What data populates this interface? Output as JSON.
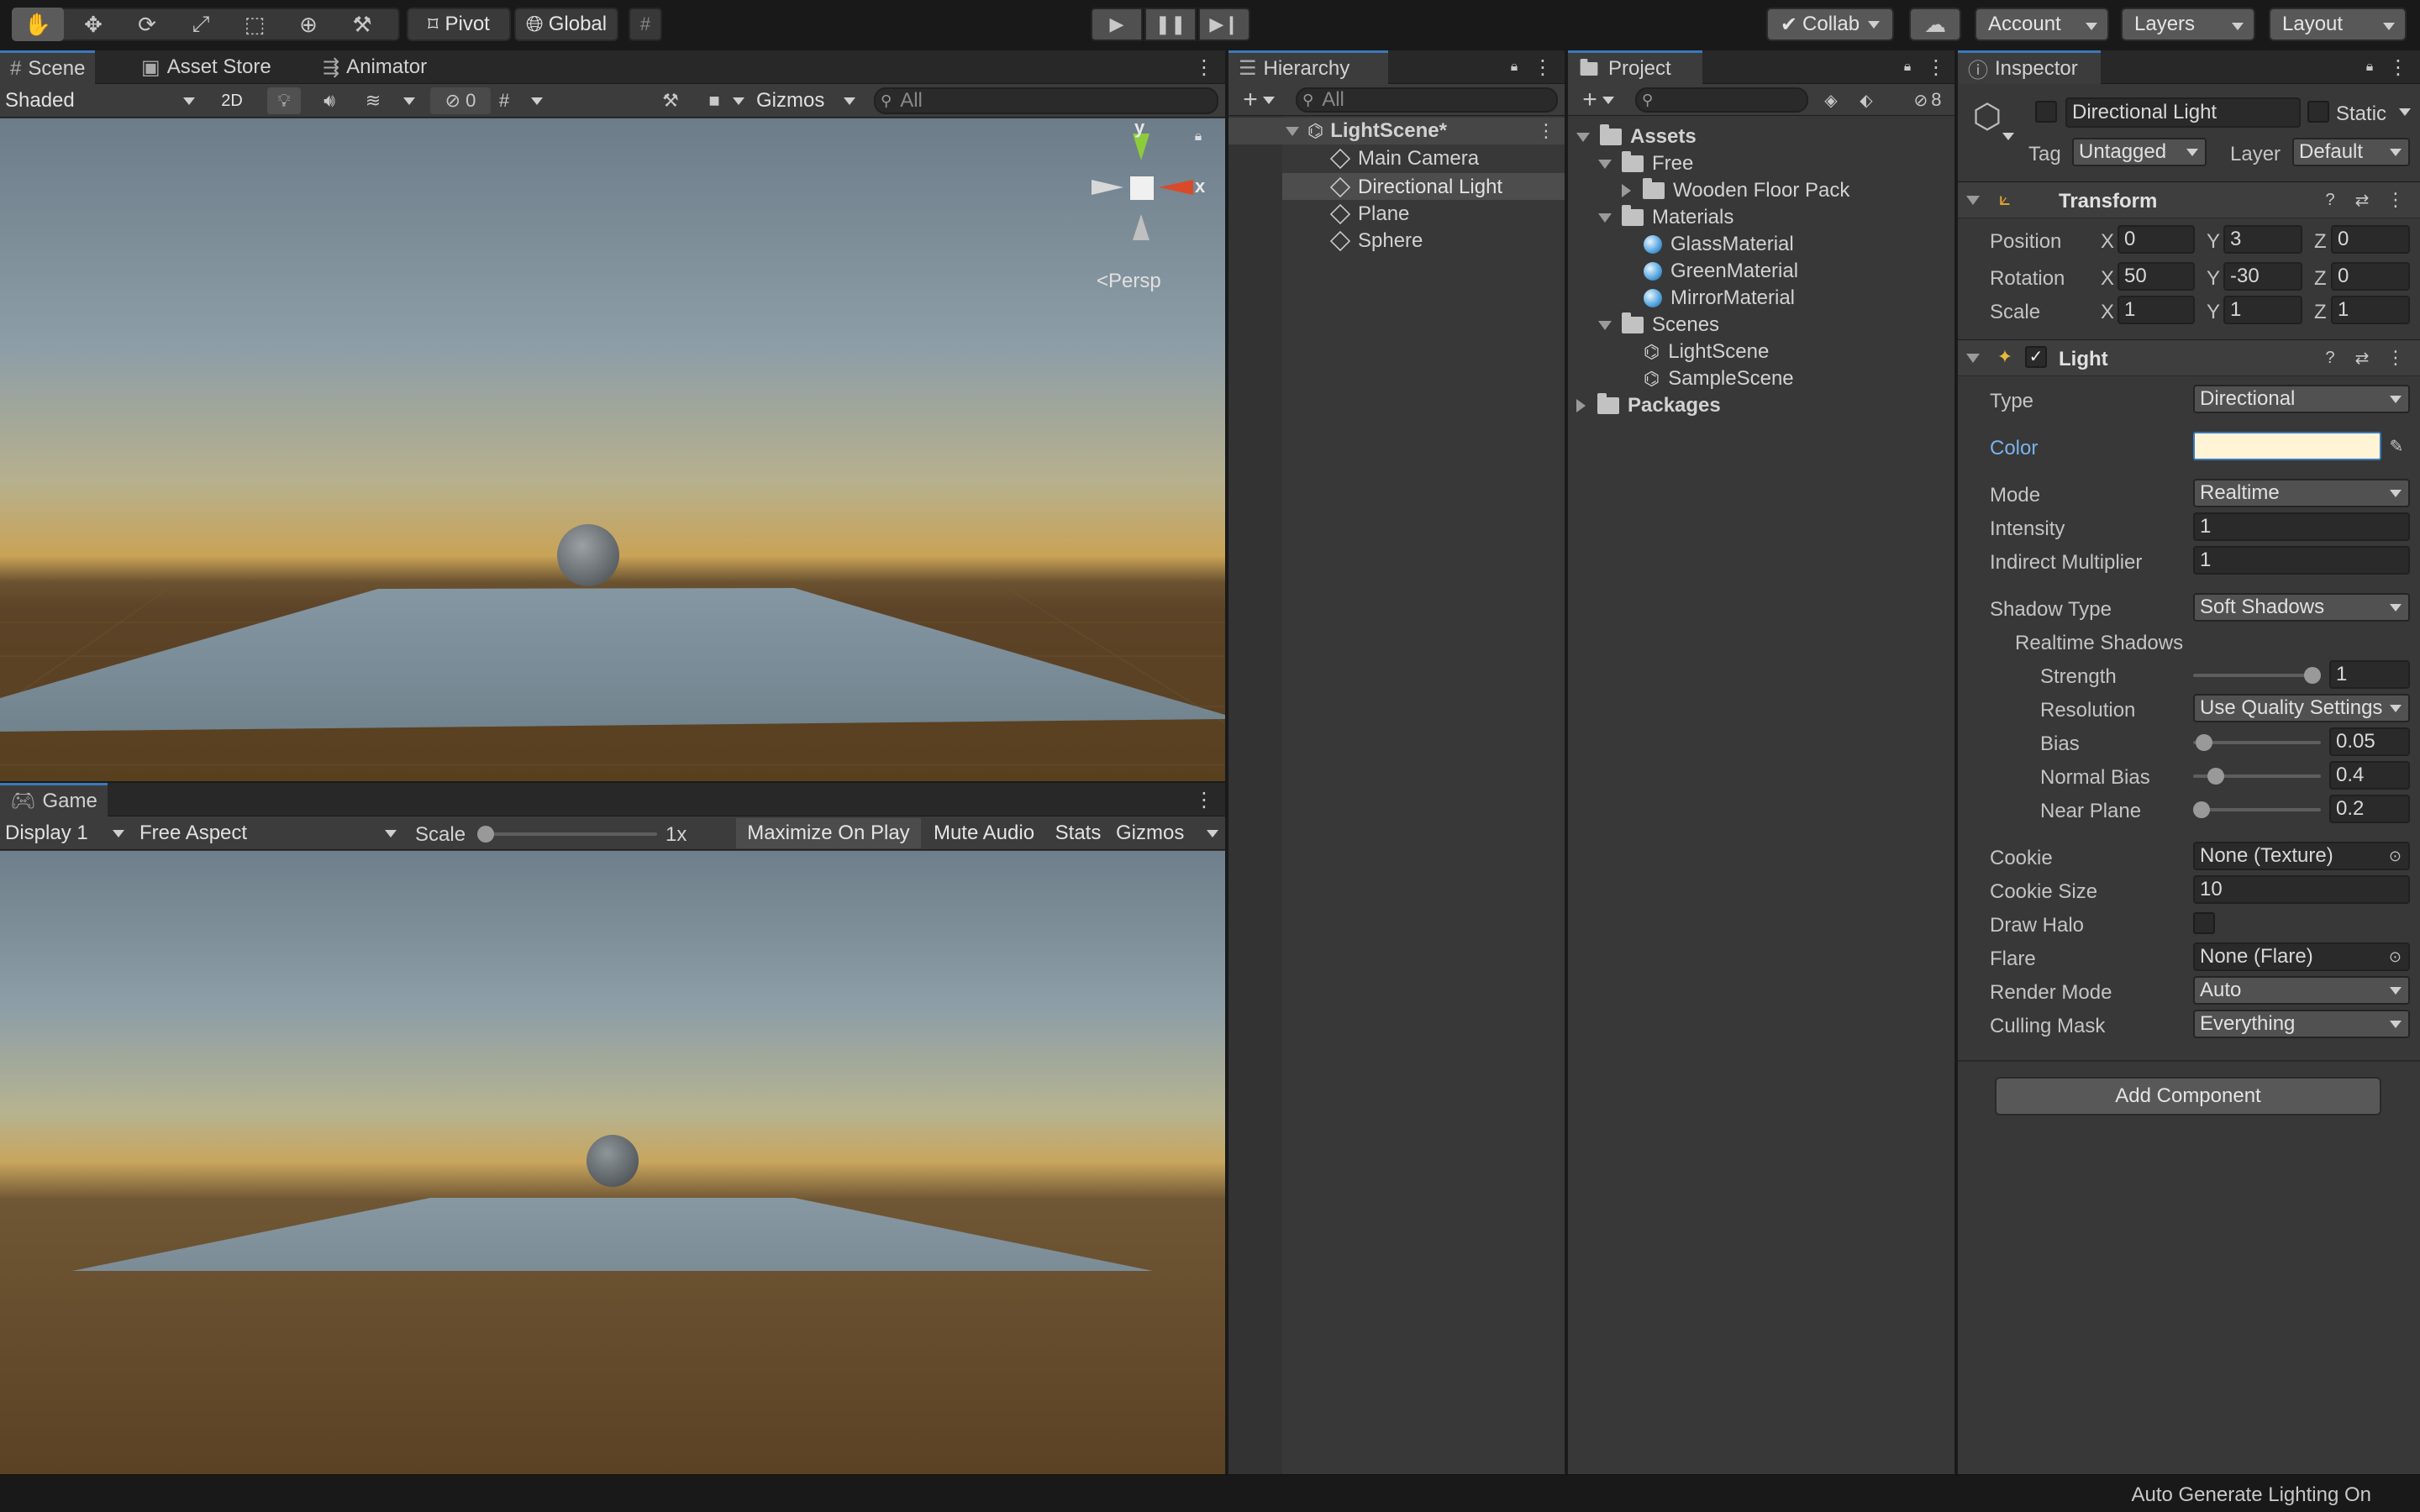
{
  "toolbar": {
    "pivot": "Pivot",
    "global": "Global",
    "collab": "Collab",
    "account": "Account",
    "layers": "Layers",
    "layout": "Layout"
  },
  "scene_panel": {
    "tabs": [
      "Scene",
      "Asset Store",
      "Animator"
    ],
    "shading_mode": "Shaded",
    "btn_2d": "2D",
    "hidden_count": "0",
    "gizmos": "Gizmos",
    "search_placeholder": "All",
    "gizmo_axis_y": "y",
    "gizmo_axis_x": "x",
    "persp_label": "Persp"
  },
  "game_panel": {
    "tab": "Game",
    "display": "Display 1",
    "aspect": "Free Aspect",
    "scale_label": "Scale",
    "scale_value": "1x",
    "maximize": "Maximize On Play",
    "mute": "Mute Audio",
    "stats": "Stats",
    "gizmos": "Gizmos"
  },
  "hierarchy": {
    "tab": "Hierarchy",
    "search_placeholder": "All",
    "scene": "LightScene*",
    "items": [
      "Main Camera",
      "Directional Light",
      "Plane",
      "Sphere"
    ],
    "selected_index": 1
  },
  "project": {
    "tab": "Project",
    "hidden_count": "8",
    "tree": {
      "assets": "Assets",
      "free": "Free",
      "wooden": "Wooden Floor Pack",
      "materials": "Materials",
      "mat_items": [
        "GlassMaterial",
        "GreenMaterial",
        "MirrorMaterial"
      ],
      "scenes": "Scenes",
      "scene_items": [
        "LightScene",
        "SampleScene"
      ],
      "packages": "Packages"
    }
  },
  "inspector": {
    "tab": "Inspector",
    "object_name": "Directional Light",
    "static_label": "Static",
    "tag_label": "Tag",
    "tag_value": "Untagged",
    "layer_label": "Layer",
    "layer_value": "Default",
    "transform": {
      "title": "Transform",
      "rows": [
        {
          "label": "Position",
          "x": "0",
          "y": "3",
          "z": "0"
        },
        {
          "label": "Rotation",
          "x": "50",
          "y": "-30",
          "z": "0"
        },
        {
          "label": "Scale",
          "x": "1",
          "y": "1",
          "z": "1"
        }
      ],
      "axis_x": "X",
      "axis_y": "Y",
      "axis_z": "Z"
    },
    "light": {
      "title": "Light",
      "type_label": "Type",
      "type_value": "Directional",
      "color_label": "Color",
      "color_value": "#fff4d6",
      "mode_label": "Mode",
      "mode_value": "Realtime",
      "intensity_label": "Intensity",
      "intensity_value": "1",
      "indirect_label": "Indirect Multiplier",
      "indirect_value": "1",
      "shadow_type_label": "Shadow Type",
      "shadow_type_value": "Soft Shadows",
      "realtime_shadows": "Realtime Shadows",
      "strength_label": "Strength",
      "strength_value": "1",
      "strength_fraction": 1.0,
      "resolution_label": "Resolution",
      "resolution_value": "Use Quality Settings",
      "bias_label": "Bias",
      "bias_value": "0.05",
      "bias_fraction": 0.025,
      "normal_bias_label": "Normal Bias",
      "normal_bias_value": "0.4",
      "normal_bias_fraction": 0.13,
      "near_plane_label": "Near Plane",
      "near_plane_value": "0.2",
      "near_plane_fraction": 0.0,
      "cookie_label": "Cookie",
      "cookie_value": "None (Texture)",
      "cookie_size_label": "Cookie Size",
      "cookie_size_value": "10",
      "draw_halo_label": "Draw Halo",
      "flare_label": "Flare",
      "flare_value": "None (Flare)",
      "render_mode_label": "Render Mode",
      "render_mode_value": "Auto",
      "culling_label": "Culling Mask",
      "culling_value": "Everything"
    },
    "add_component": "Add Component"
  },
  "status": {
    "text": "Auto Generate Lighting On"
  }
}
